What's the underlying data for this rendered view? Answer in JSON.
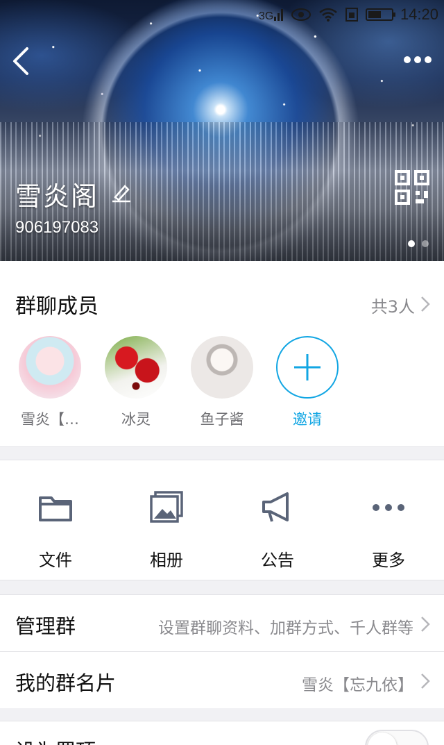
{
  "status_bar": {
    "signal_icon": "signal-icon",
    "eye_icon": "eye-icon",
    "wifi_icon": "wifi-icon",
    "sim_icon": "sim-icon",
    "battery_icon": "battery-icon",
    "time": "14:20"
  },
  "header": {
    "group_name": "雪炎阁",
    "group_id": "906197083",
    "pager_pages": 2,
    "pager_active": 1
  },
  "members": {
    "title": "群聊成员",
    "count_label": "共3人",
    "list": [
      {
        "name": "雪炎【…"
      },
      {
        "name": "冰灵"
      },
      {
        "name": "鱼子酱"
      }
    ],
    "invite_label": "邀请"
  },
  "tools": [
    {
      "label": "文件",
      "icon": "folder-icon"
    },
    {
      "label": "相册",
      "icon": "album-icon"
    },
    {
      "label": "公告",
      "icon": "megaphone-icon"
    },
    {
      "label": "更多",
      "icon": "more-dots-icon"
    }
  ],
  "settings": {
    "manage": {
      "label": "管理群",
      "value": "设置群聊资料、加群方式、千人群等"
    },
    "card": {
      "label": "我的群名片",
      "value": "雪炎【忘九依】"
    },
    "pin": {
      "label": "设为置顶",
      "enabled": false
    }
  },
  "colors": {
    "accent": "#12a6e3",
    "icon_gray": "#5a6478",
    "secondary_text": "#8a8a8e"
  }
}
